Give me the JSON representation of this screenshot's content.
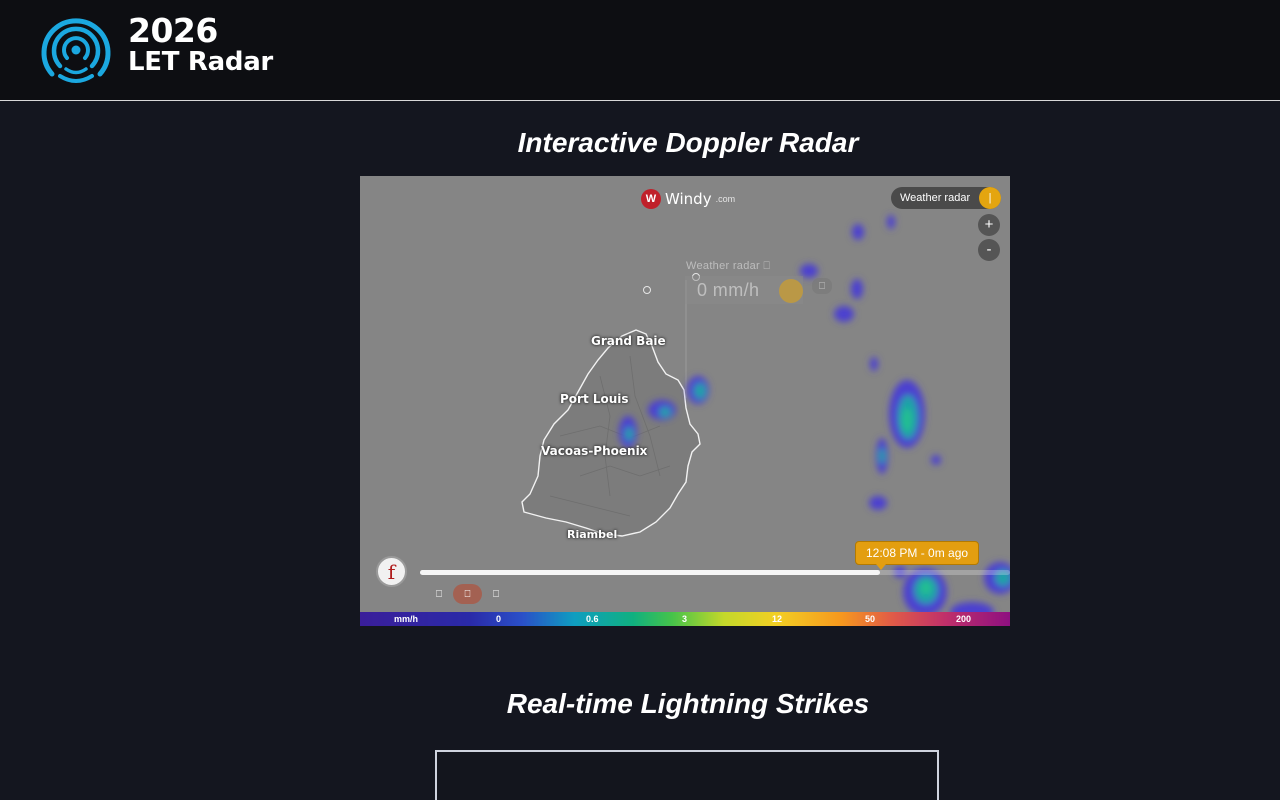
{
  "header": {
    "logo_year": "2026",
    "logo_name": "LET Radar",
    "logo_icon": "radar-signal-icon",
    "brand_color": "#1ba8e0"
  },
  "sections": {
    "radar_title": "Interactive Doppler Radar",
    "lightning_title": "Real-time Lightning Strikes"
  },
  "map": {
    "brand": "Windy",
    "brand_tld": ".com",
    "layer_label": "Weather radar",
    "zoom_in": "+",
    "zoom_out": "-",
    "picker_label": "Weather radar ⎕",
    "picker_value": "0 mm/h",
    "picker_close": "⎕",
    "play_glyph": "f",
    "timeline_progress": 0.78,
    "time_label": "12:08 PM - 0m ago",
    "ctrl_prev": "⎕",
    "ctrl_mid": "⎕",
    "ctrl_next": "⎕",
    "cities": {
      "grand_baie": "Grand Baie",
      "port_louis": "Port Louis",
      "vacoas": "Vacoas-Phoenix",
      "riambel": "Riambel"
    },
    "legend": {
      "unit": "mm/h",
      "ticks": [
        "0",
        "0.6",
        "3",
        "12",
        "50",
        "200"
      ]
    }
  }
}
